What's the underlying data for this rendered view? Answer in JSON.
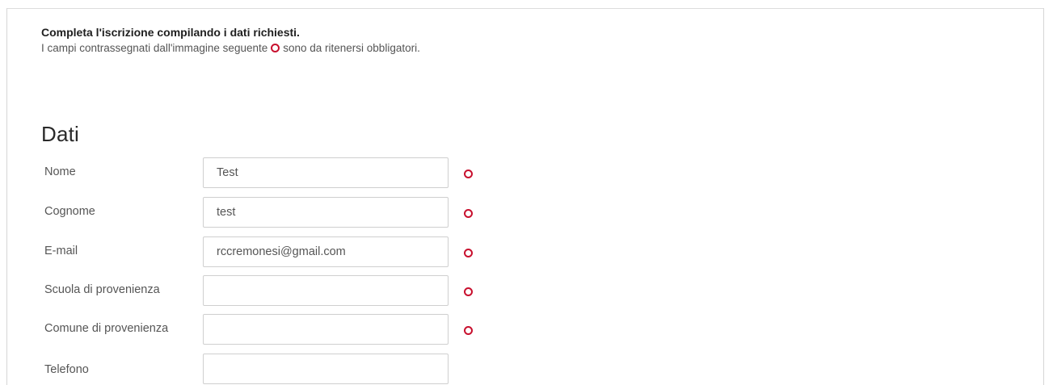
{
  "intro": {
    "title": "Completa l'iscrizione compilando i dati richiesti.",
    "text_before_icon": "I campi contrassegnati dall'immagine seguente",
    "text_after_icon": "sono da ritenersi obbligatori."
  },
  "section": {
    "title": "Dati"
  },
  "fields": [
    {
      "label": "Nome",
      "value": "Test",
      "required": true
    },
    {
      "label": "Cognome",
      "value": "test",
      "required": true
    },
    {
      "label": "E-mail",
      "value": "rccremonesi@gmail.com",
      "required": true
    },
    {
      "label": "Scuola di provenienza",
      "value": "",
      "required": true
    },
    {
      "label": "Comune di provenienza",
      "value": "",
      "required": true
    },
    {
      "label": "Telefono",
      "value": "",
      "required": false
    }
  ],
  "colors": {
    "required_icon": "#c8102e",
    "border": "#cfcfcf",
    "text": "#555555",
    "heading": "#2a2a2a"
  },
  "icons": {
    "required": "required-circle-icon"
  }
}
